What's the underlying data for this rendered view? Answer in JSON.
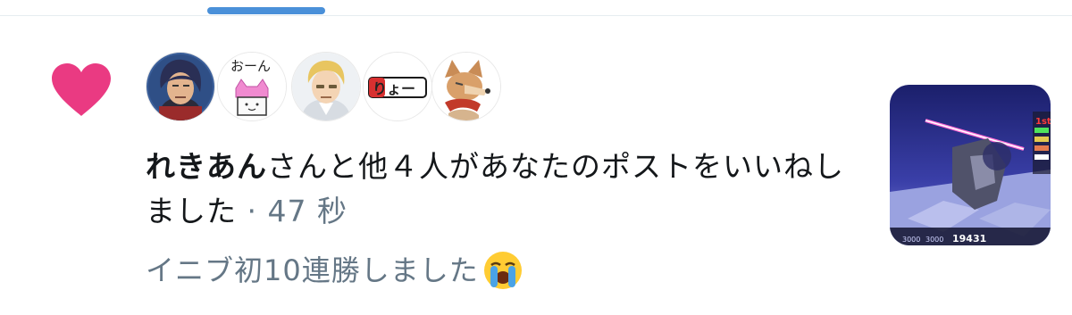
{
  "notification": {
    "type_icon": "heart-icon",
    "accent_color": "#e0245e",
    "avatars": [
      {
        "name": "avatar-user-1"
      },
      {
        "name": "avatar-user-2",
        "label": "おーん"
      },
      {
        "name": "avatar-user-3"
      },
      {
        "name": "avatar-user-4",
        "label": "りょー"
      },
      {
        "name": "avatar-user-5"
      }
    ],
    "actor_name": "れきあん",
    "message_rest": "さんと他４人があなたのポストをいいねしました",
    "separator": " · ",
    "time": "47 秒",
    "post_text": "イニブ初10連勝しました",
    "post_emoji": "loudly-crying-face-emoji",
    "thumbnail": "game-screenshot-thumbnail"
  },
  "thumbnail_labels": {
    "rank1": "1st",
    "score": "19431",
    "score_a": "3000",
    "score_b": "3000"
  }
}
